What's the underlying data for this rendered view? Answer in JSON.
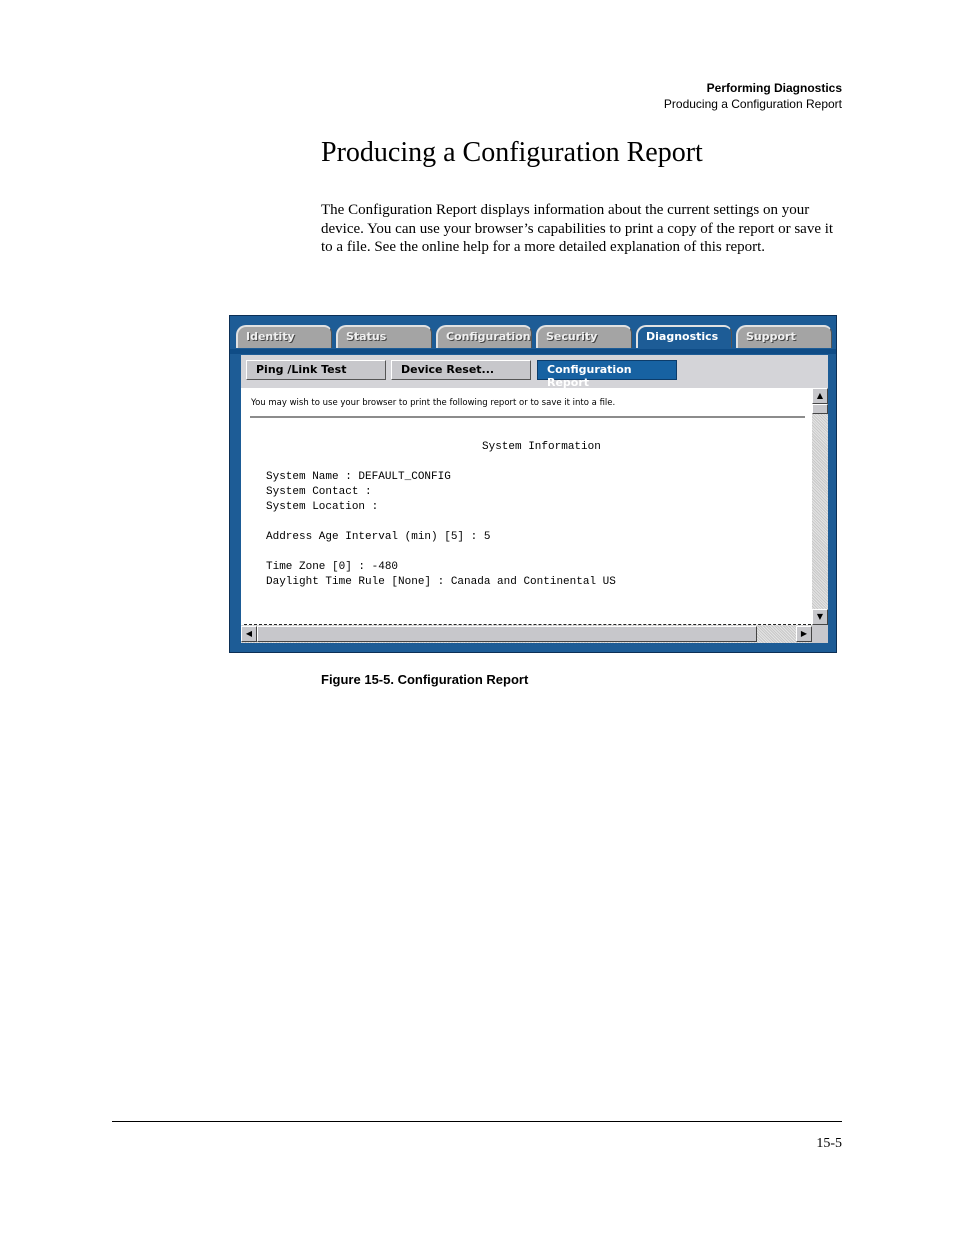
{
  "header": {
    "chapter": "Performing Diagnostics",
    "section": "Producing a Configuration Report"
  },
  "title": "Producing a Configuration Report",
  "body_text": "The Configuration Report displays information about the current settings on your device. You can use your browser’s capabilities to print a copy of the report or save it to a file. See the online help for a more detailed explanation of this report.",
  "figure": {
    "tabs": [
      {
        "label": "Identity",
        "active": false
      },
      {
        "label": "Status",
        "active": false
      },
      {
        "label": "Configuration",
        "active": false
      },
      {
        "label": "Security",
        "active": false
      },
      {
        "label": "Diagnostics",
        "active": true
      },
      {
        "label": "Support",
        "active": false
      }
    ],
    "subnav": [
      {
        "label": "Ping /Link Test",
        "active": false
      },
      {
        "label": "Device Reset...",
        "active": false
      },
      {
        "label": "Configuration Report",
        "active": true
      }
    ],
    "note": "You may wish to use your browser to print the following report or to save it into a file.",
    "report": {
      "heading": "System Information",
      "lines": [
        "System Name : DEFAULT_CONFIG",
        "System Contact :",
        "System Location :",
        "",
        "Address Age Interval (min) [5] : 5",
        "",
        "Time Zone [0] : -480",
        "Daylight Time Rule [None] : Canada and Continental US"
      ]
    },
    "scroll_icons": {
      "up": "▲",
      "down": "▼",
      "left": "◀",
      "right": "▶"
    },
    "colors": {
      "accent": "#1d5c96",
      "active_subnav": "#1762a2"
    }
  },
  "caption": "Figure 15-5.  Configuration Report",
  "page_number": "15-5"
}
